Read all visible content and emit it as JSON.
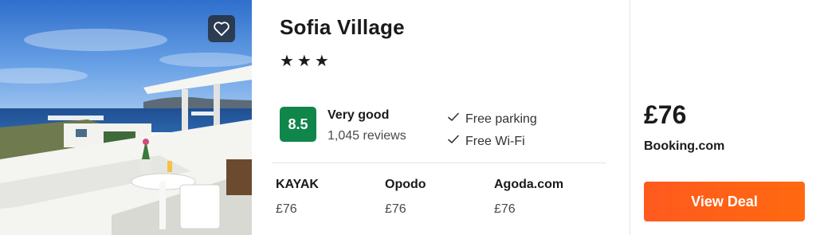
{
  "hotel": {
    "name": "Sofia Village",
    "stars_text": "★★★",
    "star_count": 3,
    "photo_icon": "favorite-heart-icon"
  },
  "rating": {
    "score": "8.5",
    "label": "Very good",
    "reviews": "1,045 reviews",
    "badge_color": "#10864a"
  },
  "amenities": [
    {
      "label": "Free parking",
      "icon": "check-icon"
    },
    {
      "label": "Free Wi-Fi",
      "icon": "check-icon"
    }
  ],
  "providers": [
    {
      "name": "KAYAK",
      "price": "£76"
    },
    {
      "name": "Opodo",
      "price": "£76"
    },
    {
      "name": "Agoda.com",
      "price": "£76"
    }
  ],
  "deal": {
    "price": "£76",
    "provider": "Booking.com",
    "button_label": "View Deal",
    "button_color": "#ff5a1f"
  }
}
